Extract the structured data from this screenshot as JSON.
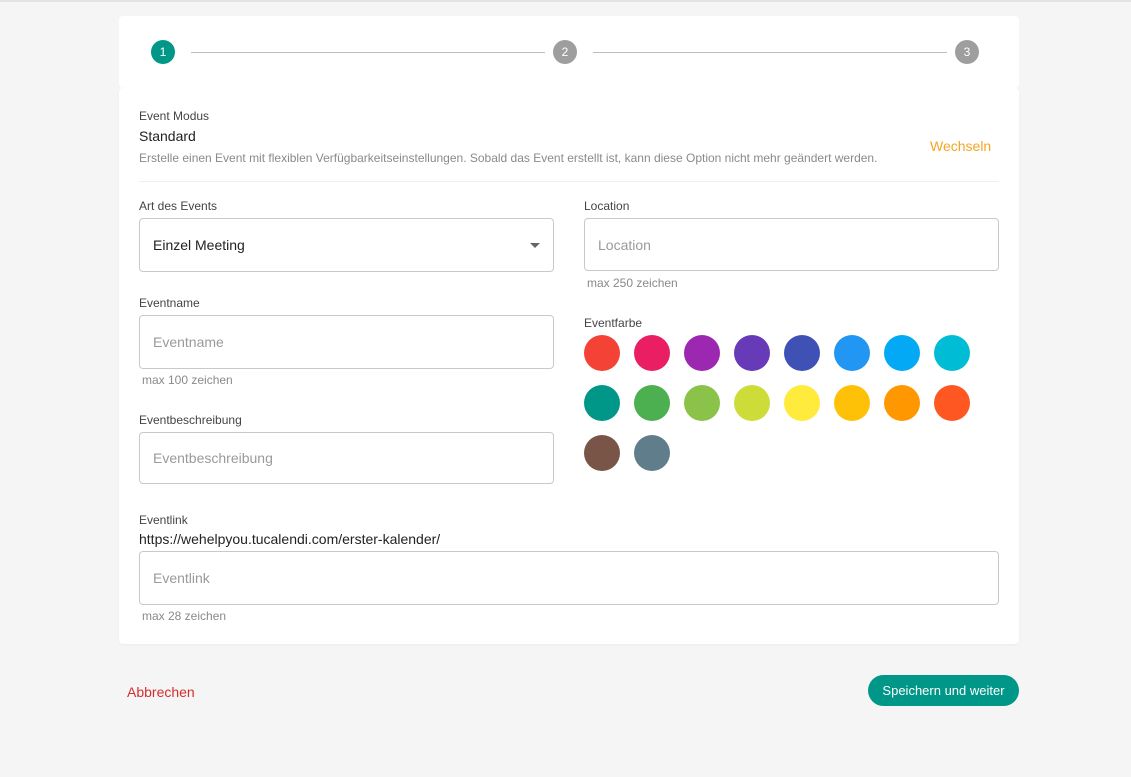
{
  "stepper": {
    "steps": [
      "1",
      "2",
      "3"
    ],
    "active_step": 1
  },
  "mode": {
    "label": "Event Modus",
    "value": "Standard",
    "description": "Erstelle einen Event mit flexiblen Verfügbarkeitseinstellungen. Sobald das Event erstellt ist, kann diese Option nicht mehr geändert werden.",
    "switch_label": "Wechseln"
  },
  "event_type": {
    "label": "Art des Events",
    "value": "Einzel Meeting"
  },
  "location": {
    "label": "Location",
    "placeholder": "Location",
    "value": "",
    "hint": "max 250 zeichen"
  },
  "event_name": {
    "label": "Eventname",
    "placeholder": "Eventname",
    "value": "",
    "hint": "max 100 zeichen"
  },
  "event_description": {
    "label": "Eventbeschreibung",
    "placeholder": "Eventbeschreibung",
    "value": ""
  },
  "event_color": {
    "label": "Eventfarbe",
    "colors": [
      "#f44336",
      "#e91e63",
      "#9c27b0",
      "#673ab7",
      "#3f51b5",
      "#2196f3",
      "#03a9f4",
      "#00bcd4",
      "#009688",
      "#4caf50",
      "#8bc34a",
      "#cddc39",
      "#ffeb3b",
      "#ffc107",
      "#ff9800",
      "#ff5722",
      "#795548",
      "#607d8b"
    ]
  },
  "event_link": {
    "label": "Eventlink",
    "base_url": "https://wehelpyou.tucalendi.com/erster-kalender/",
    "placeholder": "Eventlink",
    "value": "",
    "hint": "max 28 zeichen"
  },
  "actions": {
    "cancel_label": "Abbrechen",
    "save_label": "Speichern und weiter"
  }
}
